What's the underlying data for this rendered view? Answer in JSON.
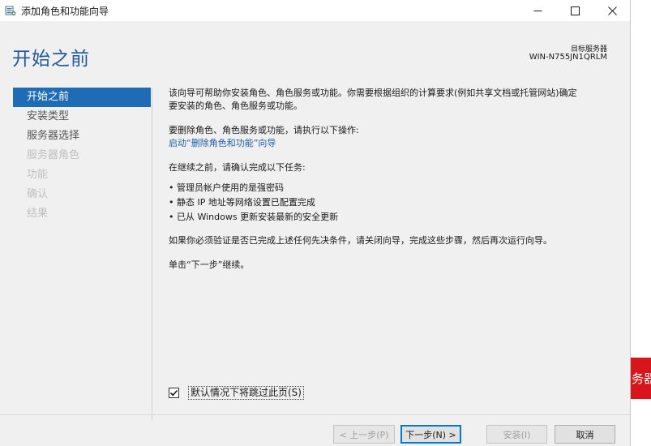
{
  "window": {
    "title": "添加角色和功能向导",
    "icons": {
      "app": "server-manager-icon",
      "minimize": "minimize-icon",
      "maximize": "maximize-icon",
      "close": "close-icon"
    }
  },
  "header": {
    "page_title": "开始之前",
    "target_label": "目标服务器",
    "target_server": "WIN-N755JN1QRLM"
  },
  "nav": {
    "items": [
      {
        "label": "开始之前",
        "state": "active"
      },
      {
        "label": "安装类型",
        "state": "enabled"
      },
      {
        "label": "服务器选择",
        "state": "enabled"
      },
      {
        "label": "服务器角色",
        "state": "disabled"
      },
      {
        "label": "功能",
        "state": "disabled"
      },
      {
        "label": "确认",
        "state": "disabled"
      },
      {
        "label": "结果",
        "state": "disabled"
      }
    ]
  },
  "content": {
    "intro_line1": "该向导可帮助你安装角色、角色服务或功能。你需要根据组织的计算要求(例如共享文档或托管网站)确定",
    "intro_line2": "要安装的角色、角色服务或功能。",
    "remove_text": "要删除角色、角色服务或功能，请执行以下操作:",
    "remove_link": "启动“删除角色和功能”向导",
    "before_text": "在继续之前，请确认完成以下任务:",
    "tasks": [
      "管理员帐户使用的是强密码",
      "静态 IP 地址等网络设置已配置完成",
      "已从 Windows 更新安装最新的安全更新"
    ],
    "verify_text": "如果你必须验证是否已完成上述任何先决条件，请关闭向导，完成这些步骤，然后再次运行向导。",
    "next_hint": "单击“下一步”继续。"
  },
  "skip_checkbox": {
    "label": "默认情况下将跳过此页(S)",
    "checked": true
  },
  "buttons": {
    "prev": "< 上一步(P)",
    "next": "下一步(N) >",
    "install": "安装(I)",
    "cancel": "取消"
  },
  "background": {
    "partial_text": "务器",
    "accent_color": "#d8151b"
  },
  "colors": {
    "heading": "#1e5a9e",
    "nav_active": "#1e6cb5",
    "link": "#1a5ea8"
  }
}
